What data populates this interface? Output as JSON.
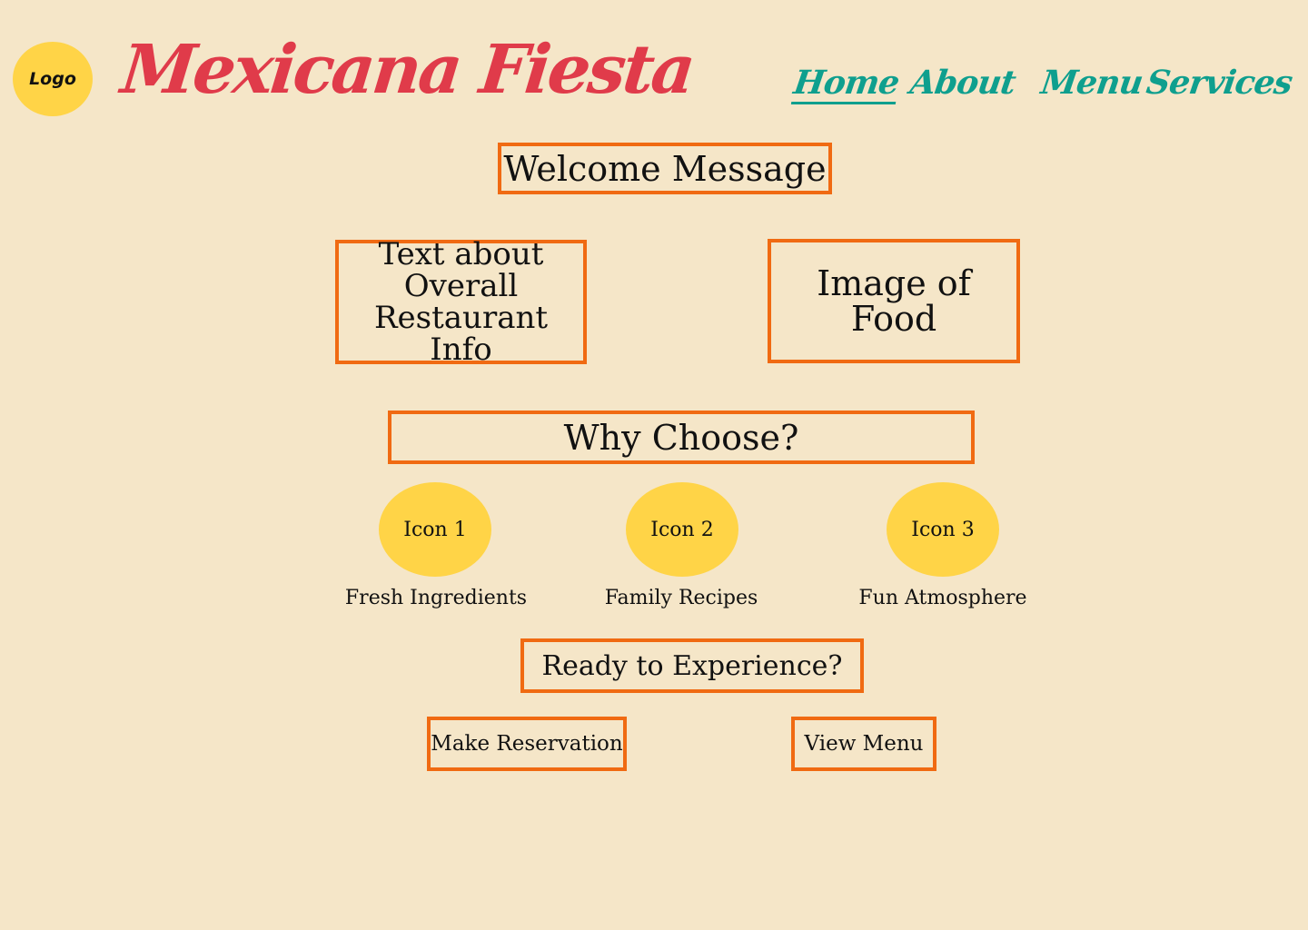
{
  "header": {
    "logo": "Logo",
    "title": "Mexicana Fiesta",
    "nav": [
      "Home",
      "About",
      "Menu",
      "Services"
    ],
    "active_nav": "Home"
  },
  "welcome": "Welcome Message",
  "info_text": "Text about Overall Restaurant Info",
  "food_image": "Image of Food",
  "why_choose": {
    "heading": "Why Choose?",
    "features": [
      {
        "icon": "Icon 1",
        "label": "Fresh Ingredients"
      },
      {
        "icon": "Icon 2",
        "label": "Family Recipes"
      },
      {
        "icon": "Icon 3",
        "label": "Fun Atmosphere"
      }
    ]
  },
  "cta": {
    "heading": "Ready to Experience?",
    "reserve_button": "Make Reservation",
    "menu_button": "View Menu"
  },
  "colors": {
    "background": "#f5e6c8",
    "brand": "#e03b4a",
    "nav": "#0f9f8e",
    "box_border": "#f06a12",
    "accent_yellow": "#ffd447"
  }
}
